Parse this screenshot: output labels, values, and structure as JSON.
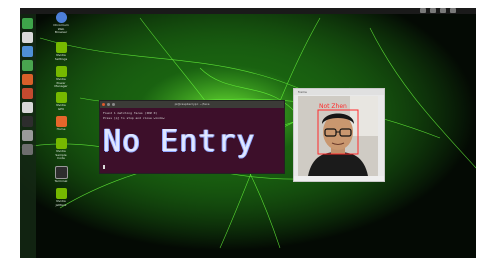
{
  "terminal": {
    "title": "pi@raspberrypi: ~/face",
    "lines": [
      "Found 1 matching faces (ID# 0)",
      "Press [q] to stop and close window"
    ],
    "big_text": "No Entry"
  },
  "camera_window": {
    "title": "frame",
    "overlay_label": "Not Zhen"
  },
  "desktop_icons": [
    {
      "label": "Chromium\nWeb\nBrowser",
      "icon": "globe-icon"
    },
    {
      "label": "Nvidia\nSettings",
      "icon": "nvidia-icon"
    },
    {
      "label": "Nvidia\nPower\nManager",
      "icon": "nvidia-icon"
    },
    {
      "label": "Nvidia\nGPU",
      "icon": "nvidia-icon"
    },
    {
      "label": "Home",
      "icon": "folder-icon"
    },
    {
      "label": "Nvidia\nSample\nCode",
      "icon": "nvidia-icon"
    },
    {
      "label": "Terminal",
      "icon": "terminal-icon"
    },
    {
      "label": "Nvidia\nJetPack",
      "icon": "nvidia-icon"
    }
  ],
  "colors": {
    "glow": "#3cff2a",
    "terminal_bg": "#3d0f2a",
    "face_box": "#ff2a2a"
  }
}
